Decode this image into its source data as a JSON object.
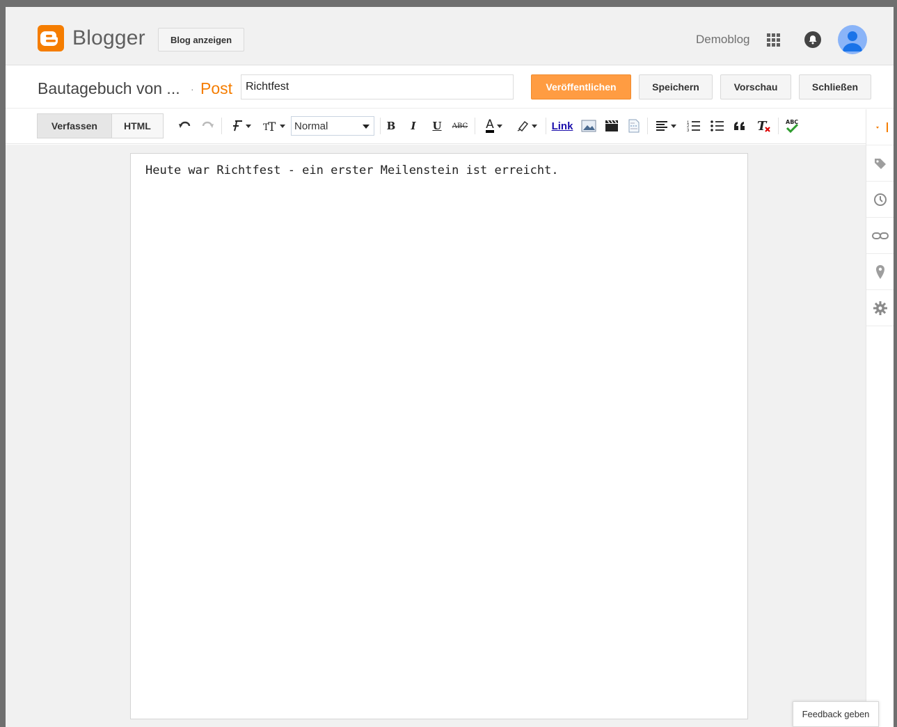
{
  "app": {
    "brand": "Blogger",
    "view_blog_label": "Blog anzeigen",
    "blog_selector": "Demoblog"
  },
  "post": {
    "blog_name": "Bautagebuch von ...",
    "separator": "·",
    "type_label": "Post",
    "title_value": "Richtfest",
    "publish_label": "Veröffentlichen",
    "save_label": "Speichern",
    "preview_label": "Vorschau",
    "close_label": "Schließen"
  },
  "toolbar": {
    "compose_tab": "Verfassen",
    "html_tab": "HTML",
    "format_value": "Normal",
    "bold": "B",
    "italic": "I",
    "underline": "U",
    "strike": "ABC",
    "text_color": "A",
    "link_label": "Link"
  },
  "editor": {
    "content": "Heute war Richtfest - ein erster Meilenstein ist erreicht."
  },
  "sidebar": {
    "icons": [
      "tag-icon",
      "clock-icon",
      "link-icon",
      "location-icon",
      "gear-icon"
    ]
  },
  "feedback_label": "Feedback geben",
  "colors": {
    "accent": "#f57d00",
    "publish_bg": "#ff9c42",
    "link": "#1a0dab"
  }
}
